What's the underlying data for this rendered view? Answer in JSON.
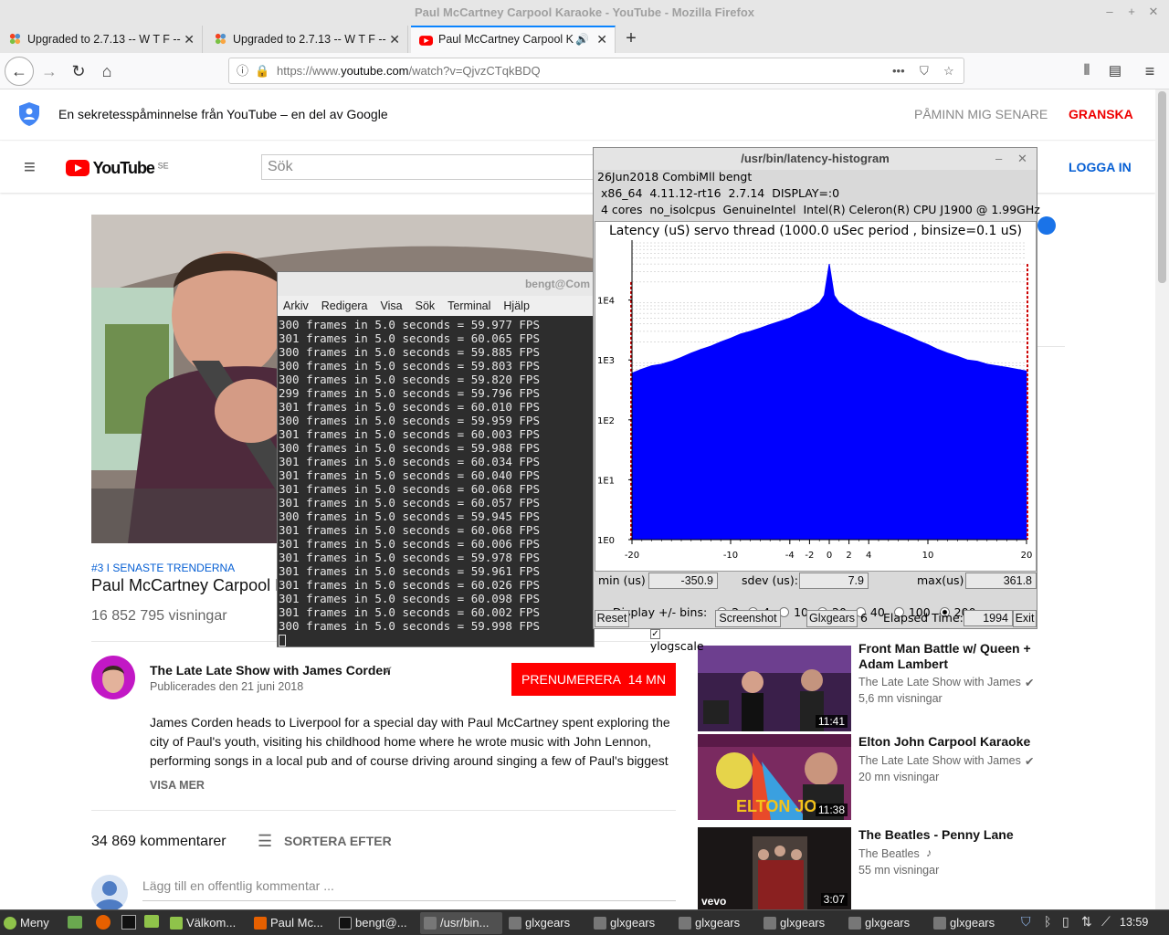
{
  "firefox": {
    "window_title": "Paul McCartney Carpool Karaoke - YouTube - Mozilla Firefox",
    "tabs": [
      {
        "label": "Upgraded to 2.7.13 -- W T F --",
        "active": false
      },
      {
        "label": "Upgraded to 2.7.13 -- W T F --",
        "active": false
      },
      {
        "label": "Paul McCartney Carpool K",
        "active": true
      }
    ],
    "url_prefix": "https://www.",
    "url_domain": "youtube.com",
    "url_suffix": "/watch?v=QjvzCTqkBDQ"
  },
  "youtube": {
    "privacy_text": "En sekretesspåminnelse från YouTube – en del av Google",
    "remind_later": "PÅMINN MIG SENARE",
    "review": "GRANSKA",
    "logo_text": "YouTube",
    "logo_region": "SE",
    "search_placeholder": "Sök",
    "sign_in": "LOGGA IN",
    "trending_tag": "#3 I SENASTE TRENDERNA",
    "video_title": "Paul McCartney Carpool K",
    "views": "16 852 795 visningar",
    "channel": "The Late Late Show with James Corden",
    "published": "Publicerades den 21 juni 2018",
    "subscribe": "PRENUMERERA",
    "subscribers": "14 MN",
    "description": "James Corden heads to Liverpool for a special day with Paul McCartney spent exploring the city of Paul's youth, visiting his childhood home where he wrote music with John Lennon, performing songs in a local pub and of course driving around singing a few of Paul's biggest",
    "show_more": "VISA MER",
    "comments_count": "34 869 kommentarer",
    "sort_by": "SORTERA EFTER",
    "add_comment": "Lägg till en offentlig kommentar ...",
    "related": [
      {
        "title": "Front Man Battle w/ Queen + Adam Lambert",
        "channel": "The Late Late Show with James",
        "views": "5,6 mn visningar",
        "duration": "11:41"
      },
      {
        "title": "Elton John Carpool Karaoke",
        "channel": "The Late Late Show with James",
        "views": "20 mn visningar",
        "duration": "11:38",
        "overlay": "ELTON JO"
      },
      {
        "title": "The Beatles - Penny Lane",
        "channel": "The Beatles",
        "views": "55 mn visningar",
        "duration": "3:07",
        "overlay": "vevo"
      }
    ]
  },
  "terminal": {
    "title": "bengt@Com",
    "menu": [
      "Arkiv",
      "Redigera",
      "Visa",
      "Sök",
      "Terminal",
      "Hjälp"
    ],
    "lines": [
      "300 frames in 5.0 seconds = 59.977 FPS",
      "301 frames in 5.0 seconds = 60.065 FPS",
      "300 frames in 5.0 seconds = 59.885 FPS",
      "300 frames in 5.0 seconds = 59.803 FPS",
      "300 frames in 5.0 seconds = 59.820 FPS",
      "299 frames in 5.0 seconds = 59.796 FPS",
      "301 frames in 5.0 seconds = 60.010 FPS",
      "300 frames in 5.0 seconds = 59.959 FPS",
      "301 frames in 5.0 seconds = 60.003 FPS",
      "300 frames in 5.0 seconds = 59.988 FPS",
      "301 frames in 5.0 seconds = 60.034 FPS",
      "301 frames in 5.0 seconds = 60.040 FPS",
      "301 frames in 5.0 seconds = 60.068 FPS",
      "301 frames in 5.0 seconds = 60.057 FPS",
      "300 frames in 5.0 seconds = 59.945 FPS",
      "301 frames in 5.0 seconds = 60.068 FPS",
      "301 frames in 5.0 seconds = 60.006 FPS",
      "301 frames in 5.0 seconds = 59.978 FPS",
      "301 frames in 5.0 seconds = 59.961 FPS",
      "301 frames in 5.0 seconds = 60.026 FPS",
      "301 frames in 5.0 seconds = 60.098 FPS",
      "301 frames in 5.0 seconds = 60.002 FPS",
      "300 frames in 5.0 seconds = 59.998 FPS"
    ]
  },
  "histogram": {
    "window_title": "/usr/bin/latency-histogram",
    "info1": "26Jun2018 CombiMll bengt",
    "info2": " x86_64  4.11.12-rt16  2.7.14  DISPLAY=:0",
    "info3": " 4 cores  no_isolcpus  GenuineIntel  Intel(R) Celeron(R) CPU J1900 @ 1.99GHz",
    "min_label": "min (us)",
    "min_value": "-350.9",
    "sdev_label": "sdev (us):",
    "sdev_value": "7.9",
    "max_label": "max(us)",
    "max_value": "361.8",
    "display_label": "Display +/- bins:",
    "bin_options": [
      "2",
      "4",
      "10",
      "20",
      "40",
      "100",
      "200"
    ],
    "bin_selected": "200",
    "reset": "Reset",
    "ylogscale": "ylogscale",
    "ylogscale_checked": true,
    "screenshot": "Screenshot",
    "glxgears": "Glxgears",
    "glxgears_count": "6",
    "elapsed_label": "Elapsed Time:",
    "elapsed_value": "1994",
    "exit": "Exit"
  },
  "chart_data": {
    "type": "bar",
    "title": "Latency (uS) servo thread (1000.0 uSec period , binsize=0.1 uS)",
    "xlabel": "",
    "ylabel": "",
    "x_ticks": [
      "-20",
      "-10",
      "-4",
      "-2",
      "0",
      "2",
      "4",
      "10",
      "20"
    ],
    "y_ticks": [
      "1E0",
      "1E1",
      "1E2",
      "1E3",
      "1E4"
    ],
    "y_scale": "log",
    "xlim": [
      -20,
      20
    ],
    "ylim": [
      1,
      100000
    ],
    "grid": "horizontal",
    "color": "#0000ff",
    "outlier_color": "#cc0000",
    "series": [
      {
        "x": [
          -20,
          -19,
          -18,
          -17,
          -16,
          -15,
          -14,
          -13,
          -12,
          -11,
          -10,
          -9,
          -8,
          -7,
          -6,
          -5,
          -4,
          -3,
          -2,
          -1,
          -0.5,
          0,
          0.5,
          1,
          2,
          3,
          4,
          5,
          6,
          7,
          8,
          9,
          10,
          11,
          12,
          13,
          14,
          15,
          16,
          17,
          18,
          19,
          20
        ],
        "values": [
          600,
          700,
          800,
          850,
          950,
          1100,
          1300,
          1500,
          1700,
          2000,
          2300,
          2700,
          3000,
          3400,
          3900,
          4400,
          5000,
          6000,
          7000,
          9000,
          12000,
          40000,
          12000,
          9000,
          7000,
          5500,
          4600,
          4000,
          3400,
          2900,
          2500,
          2100,
          1800,
          1500,
          1300,
          1150,
          1000,
          950,
          850,
          800,
          750,
          700,
          650
        ]
      }
    ]
  },
  "taskbar": {
    "menu": "Meny",
    "tasks": [
      "Välkom...",
      "Paul Mc...",
      "bengt@...",
      "/usr/bin...",
      "glxgears",
      "glxgears",
      "glxgears",
      "glxgears",
      "glxgears",
      "glxgears"
    ],
    "clock": "13:59"
  },
  "colors": {
    "yt_red": "#ff0000",
    "link_blue": "#065fd4",
    "firefox_blue": "#0a84ff",
    "histogram_blue": "#0000ff"
  }
}
